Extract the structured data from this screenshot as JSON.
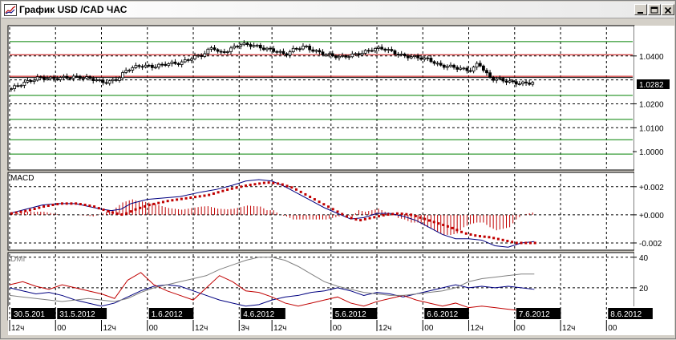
{
  "window": {
    "title": "График USD /CAD  ЧАС",
    "minimize_label": "_",
    "maximize_label": "□",
    "close_label": "✕"
  },
  "colors": {
    "background": "#ffffff",
    "grid": "#000000",
    "resistance_line": "#c00000",
    "support_line": "#008000",
    "macd_line": "#000080",
    "signal_dots": "#c00000",
    "histogram": "#c00000",
    "dmi_plus": "#000080",
    "dmi_minus": "#c00000",
    "adx": "#808080",
    "candle": "#000000"
  },
  "chart_data": [
    {
      "panel": "price",
      "type": "candlestick",
      "title": "",
      "y_ticks": [
        "1.0400",
        "1.0200",
        "1.0100",
        "1.0000"
      ],
      "current_price_label": "1.0282",
      "ylim": [
        0.993,
        1.052
      ],
      "horizontal_levels": [
        {
          "value": 1.046,
          "color": "#008000"
        },
        {
          "value": 1.0405,
          "color": "#c00000"
        },
        {
          "value": 1.0315,
          "color": "#c00000"
        },
        {
          "value": 1.031,
          "color": "#000000"
        },
        {
          "value": 1.0235,
          "color": "#008000"
        },
        {
          "value": 1.0135,
          "color": "#008000"
        },
        {
          "value": 1.005,
          "color": "#008000"
        },
        {
          "value": 0.999,
          "color": "#008000"
        }
      ],
      "close_path": [
        [
          0,
          1.026
        ],
        [
          3,
          1.028
        ],
        [
          6,
          1.0295
        ],
        [
          9,
          1.031
        ],
        [
          13,
          1.0305
        ],
        [
          17,
          1.031
        ],
        [
          21,
          1.0312
        ],
        [
          25,
          1.0305
        ],
        [
          28,
          1.0292
        ],
        [
          30,
          1.029
        ],
        [
          33,
          1.0305
        ],
        [
          36,
          1.0345
        ],
        [
          40,
          1.036
        ],
        [
          44,
          1.0355
        ],
        [
          48,
          1.0368
        ],
        [
          52,
          1.037
        ],
        [
          56,
          1.0395
        ],
        [
          59,
          1.0405
        ],
        [
          62,
          1.044
        ],
        [
          64,
          1.041
        ],
        [
          67,
          1.0425
        ],
        [
          70,
          1.045
        ],
        [
          74,
          1.0445
        ],
        [
          78,
          1.043
        ],
        [
          81,
          1.0422
        ],
        [
          84,
          1.0405
        ],
        [
          87,
          1.043
        ],
        [
          90,
          1.044
        ],
        [
          93,
          1.042
        ],
        [
          97,
          1.0405
        ],
        [
          101,
          1.0395
        ],
        [
          105,
          1.0405
        ],
        [
          108,
          1.0415
        ],
        [
          111,
          1.043
        ],
        [
          114,
          1.0432
        ],
        [
          117,
          1.0415
        ],
        [
          120,
          1.04
        ],
        [
          124,
          1.0395
        ],
        [
          128,
          1.0385
        ],
        [
          131,
          1.036
        ],
        [
          135,
          1.0355
        ],
        [
          138,
          1.0345
        ],
        [
          141,
          1.034
        ],
        [
          143,
          1.0375
        ],
        [
          145,
          1.033
        ],
        [
          147,
          1.0305
        ],
        [
          150,
          1.03
        ],
        [
          153,
          1.029
        ],
        [
          156,
          1.0285
        ],
        [
          159,
          1.0288
        ],
        [
          160,
          1.029
        ]
      ]
    },
    {
      "panel": "macd",
      "type": "line",
      "title": "MACD",
      "y_ticks": [
        "+0.002",
        "+0.000",
        "-0.002"
      ],
      "ylim": [
        -0.0024,
        0.0029
      ],
      "macd_line": [
        [
          0,
          0.0001
        ],
        [
          5,
          0.0004
        ],
        [
          10,
          0.0007
        ],
        [
          15,
          0.0008
        ],
        [
          20,
          0.0008
        ],
        [
          24,
          0.0006
        ],
        [
          28,
          0.0004
        ],
        [
          31,
          0.0003
        ],
        [
          34,
          0.0004
        ],
        [
          37,
          0.0008
        ],
        [
          42,
          0.0011
        ],
        [
          47,
          0.0012
        ],
        [
          52,
          0.0013
        ],
        [
          58,
          0.0016
        ],
        [
          63,
          0.0018
        ],
        [
          68,
          0.0021
        ],
        [
          72,
          0.0024
        ],
        [
          76,
          0.0025
        ],
        [
          80,
          0.0024
        ],
        [
          84,
          0.002
        ],
        [
          88,
          0.0015
        ],
        [
          92,
          0.001
        ],
        [
          96,
          0.0005
        ],
        [
          100,
          0.0001
        ],
        [
          104,
          -0.0003
        ],
        [
          108,
          -0.0002
        ],
        [
          112,
          0.0001
        ],
        [
          116,
          0.0001
        ],
        [
          120,
          -0.0001
        ],
        [
          124,
          -0.0004
        ],
        [
          128,
          -0.0009
        ],
        [
          132,
          -0.0014
        ],
        [
          136,
          -0.0017
        ],
        [
          140,
          -0.0017
        ],
        [
          144,
          -0.0018
        ],
        [
          148,
          -0.0022
        ],
        [
          152,
          -0.0023
        ],
        [
          156,
          -0.002
        ],
        [
          160,
          -0.0019
        ]
      ],
      "signal_line": [
        [
          0,
          0.0001
        ],
        [
          5,
          0.0003
        ],
        [
          10,
          0.0006
        ],
        [
          15,
          0.0008
        ],
        [
          20,
          0.0008
        ],
        [
          25,
          0.0006
        ],
        [
          30,
          0.0002
        ],
        [
          34,
          0.0
        ],
        [
          38,
          0.0004
        ],
        [
          42,
          0.0007
        ],
        [
          48,
          0.001
        ],
        [
          54,
          0.0012
        ],
        [
          60,
          0.0014
        ],
        [
          66,
          0.0018
        ],
        [
          72,
          0.0021
        ],
        [
          78,
          0.0023
        ],
        [
          82,
          0.0022
        ],
        [
          86,
          0.0019
        ],
        [
          90,
          0.0014
        ],
        [
          94,
          0.0009
        ],
        [
          98,
          0.0004
        ],
        [
          102,
          -0.0001
        ],
        [
          106,
          -0.0004
        ],
        [
          110,
          -0.0002
        ],
        [
          114,
          0.0
        ],
        [
          118,
          0.0001
        ],
        [
          122,
          0.0
        ],
        [
          126,
          -0.0003
        ],
        [
          130,
          -0.0006
        ],
        [
          134,
          -0.0009
        ],
        [
          138,
          -0.0013
        ],
        [
          142,
          -0.0015
        ],
        [
          146,
          -0.0016
        ],
        [
          150,
          -0.0018
        ],
        [
          154,
          -0.002
        ],
        [
          158,
          -0.002
        ],
        [
          160,
          -0.002
        ]
      ]
    },
    {
      "panel": "dmi",
      "type": "line",
      "title": "DMI",
      "y_ticks": [
        "40",
        "20"
      ],
      "ylim": [
        0,
        42
      ],
      "series": [
        {
          "id": "dmi_plus",
          "color": "#000080",
          "values": [
            [
              0,
              20
            ],
            [
              4,
              18
            ],
            [
              8,
              16
            ],
            [
              12,
              17
            ],
            [
              16,
              15
            ],
            [
              20,
              12
            ],
            [
              24,
              10
            ],
            [
              28,
              8
            ],
            [
              32,
              10
            ],
            [
              36,
              14
            ],
            [
              40,
              18
            ],
            [
              44,
              21
            ],
            [
              48,
              22
            ],
            [
              52,
              21
            ],
            [
              56,
              18
            ],
            [
              60,
              15
            ],
            [
              64,
              12
            ],
            [
              68,
              10
            ],
            [
              72,
              8
            ],
            [
              76,
              9
            ],
            [
              80,
              12
            ],
            [
              84,
              14
            ],
            [
              88,
              15
            ],
            [
              92,
              17
            ],
            [
              96,
              18
            ],
            [
              100,
              20
            ],
            [
              104,
              18
            ],
            [
              108,
              15
            ],
            [
              112,
              17
            ],
            [
              116,
              16
            ],
            [
              120,
              14
            ],
            [
              124,
              16
            ],
            [
              128,
              18
            ],
            [
              132,
              20
            ],
            [
              136,
              22
            ],
            [
              140,
              20
            ],
            [
              144,
              21
            ],
            [
              148,
              20
            ],
            [
              152,
              21
            ],
            [
              156,
              20
            ],
            [
              160,
              19
            ]
          ]
        },
        {
          "id": "dmi_minus",
          "color": "#c00000",
          "values": [
            [
              0,
              22
            ],
            [
              4,
              24
            ],
            [
              8,
              21
            ],
            [
              12,
              19
            ],
            [
              16,
              22
            ],
            [
              20,
              20
            ],
            [
              24,
              18
            ],
            [
              28,
              16
            ],
            [
              32,
              13
            ],
            [
              36,
              25
            ],
            [
              40,
              30
            ],
            [
              44,
              22
            ],
            [
              48,
              18
            ],
            [
              52,
              15
            ],
            [
              56,
              12
            ],
            [
              60,
              20
            ],
            [
              64,
              28
            ],
            [
              68,
              24
            ],
            [
              72,
              18
            ],
            [
              76,
              17
            ],
            [
              80,
              14
            ],
            [
              84,
              10
            ],
            [
              88,
              8
            ],
            [
              92,
              10
            ],
            [
              96,
              12
            ],
            [
              100,
              14
            ],
            [
              104,
              10
            ],
            [
              108,
              8
            ],
            [
              112,
              11
            ],
            [
              116,
              13
            ],
            [
              120,
              15
            ],
            [
              124,
              12
            ],
            [
              128,
              10
            ],
            [
              132,
              8
            ],
            [
              136,
              10
            ],
            [
              140,
              7
            ],
            [
              144,
              8
            ],
            [
              148,
              7
            ],
            [
              152,
              6
            ],
            [
              156,
              5
            ],
            [
              160,
              5
            ]
          ]
        },
        {
          "id": "adx",
          "color": "#808080",
          "values": [
            [
              0,
              15
            ],
            [
              4,
              14
            ],
            [
              8,
              13
            ],
            [
              12,
              12
            ],
            [
              16,
              11
            ],
            [
              20,
              12
            ],
            [
              24,
              13
            ],
            [
              28,
              12
            ],
            [
              32,
              11
            ],
            [
              36,
              13
            ],
            [
              40,
              17
            ],
            [
              44,
              20
            ],
            [
              48,
              22
            ],
            [
              52,
              24
            ],
            [
              56,
              26
            ],
            [
              60,
              28
            ],
            [
              64,
              32
            ],
            [
              68,
              35
            ],
            [
              72,
              38
            ],
            [
              76,
              40
            ],
            [
              80,
              40
            ],
            [
              84,
              38
            ],
            [
              88,
              34
            ],
            [
              92,
              29
            ],
            [
              96,
              24
            ],
            [
              100,
              21
            ],
            [
              104,
              19
            ],
            [
              108,
              17
            ],
            [
              112,
              16
            ],
            [
              116,
              15
            ],
            [
              120,
              15
            ],
            [
              124,
              16
            ],
            [
              128,
              17
            ],
            [
              132,
              18
            ],
            [
              136,
              20
            ],
            [
              140,
              24
            ],
            [
              144,
              26
            ],
            [
              148,
              27
            ],
            [
              152,
              28
            ],
            [
              156,
              29
            ],
            [
              160,
              29
            ]
          ]
        }
      ]
    }
  ],
  "x_axis": {
    "date_labels": [
      {
        "text": "30.5.201",
        "bar": 0
      },
      {
        "text": "31.5.2012",
        "bar": 14
      },
      {
        "text": "1.6.2012",
        "bar": 42
      },
      {
        "text": "4.6.2012",
        "bar": 70
      },
      {
        "text": "5.6.2012",
        "bar": 98
      },
      {
        "text": "6.6.2012",
        "bar": 126
      },
      {
        "text": "7.6.2012",
        "bar": 154
      },
      {
        "text": "8.6.2012",
        "bar": 182
      }
    ],
    "hour_labels": [
      {
        "text": "12ч",
        "bar": 0
      },
      {
        "text": "00",
        "bar": 14
      },
      {
        "text": "12ч",
        "bar": 28
      },
      {
        "text": "00",
        "bar": 42
      },
      {
        "text": "12ч",
        "bar": 56
      },
      {
        "text": "3ч",
        "bar": 70
      },
      {
        "text": "12ч",
        "bar": 80
      },
      {
        "text": "00",
        "bar": 98
      },
      {
        "text": "12ч",
        "bar": 112
      },
      {
        "text": "00",
        "bar": 126
      },
      {
        "text": "12ч",
        "bar": 140
      },
      {
        "text": "00",
        "bar": 154
      },
      {
        "text": "12ч",
        "bar": 168
      },
      {
        "text": "00",
        "bar": 182
      }
    ],
    "total_bars": 190,
    "data_bars": 160
  }
}
